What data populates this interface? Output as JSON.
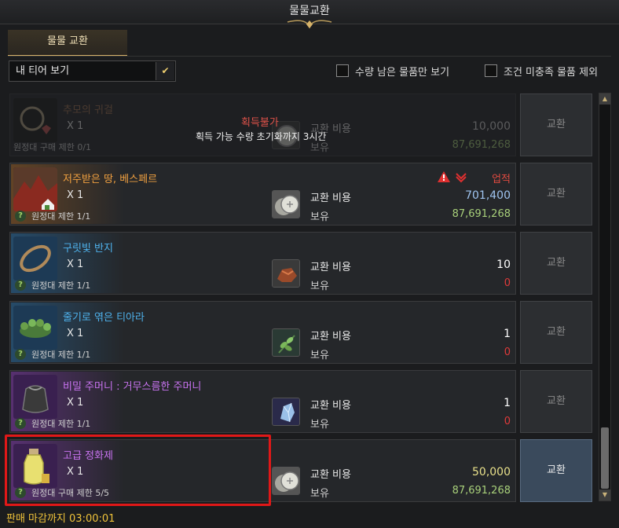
{
  "window": {
    "title": "물물교환"
  },
  "tabs": [
    {
      "label": "물물 교환"
    }
  ],
  "filter": {
    "dropdown_value": "내 티어 보기",
    "checkbox_remaining": "수량 남은 물품만 보기",
    "checkbox_exclude": "조건 미충족 물품 제외"
  },
  "common": {
    "cost_label": "교환 비용",
    "owned_label": "보유",
    "exchange_button": "교환"
  },
  "items": [
    {
      "name": "추모의 귀걸",
      "qty": "X 1",
      "limit": "원정대 구매 제한 0/1",
      "cost": "10,000",
      "owned": "87,691,268",
      "unavailable_title": "획득불가",
      "unavailable_note": "획득 가능 수량 초기화까지 3시간",
      "name_color": "#a07050",
      "cost_color": "#cfcfcf",
      "owned_color": "#a8d07a",
      "material_icon": "silver-coin-icon",
      "item_icon": "earring-icon"
    },
    {
      "name": "저주받은 땅, 베스페르",
      "qty": "X 1",
      "limit": "원정대 제한 1/1",
      "cost": "701,400",
      "owned": "87,691,268",
      "tag": "업적",
      "name_color": "#f0a040",
      "cost_color": "#9fc4f0",
      "owned_color": "#a8d07a",
      "material_icon": "silver-coin-icon",
      "item_icon": "island-icon"
    },
    {
      "name": "구릿빛 반지",
      "qty": "X 1",
      "limit": "원정대 제한 1/1",
      "cost": "10",
      "owned": "0",
      "name_color": "#4fb3ee",
      "cost_color": "#ffffff",
      "owned_color": "#e03a3a",
      "material_icon": "copper-ore-icon",
      "item_icon": "ring-icon"
    },
    {
      "name": "줄기로 엮은 티아라",
      "qty": "X 1",
      "limit": "원정대 제한 1/1",
      "cost": "1",
      "owned": "0",
      "name_color": "#4fb3ee",
      "cost_color": "#ffffff",
      "owned_color": "#e03a3a",
      "material_icon": "herb-icon",
      "item_icon": "tiara-icon"
    },
    {
      "name": "비밀 주머니 : 거무스름한 주머니",
      "qty": "X 1",
      "limit": "원정대 제한 1/1",
      "cost": "1",
      "owned": "0",
      "name_color": "#c873f0",
      "cost_color": "#ffffff",
      "owned_color": "#e03a3a",
      "material_icon": "crystal-icon",
      "item_icon": "pouch-icon"
    },
    {
      "name": "고급 정화제",
      "qty": "X 1",
      "limit": "원정대 구매 제한 5/5",
      "cost": "50,000",
      "owned": "87,691,268",
      "name_color": "#c873f0",
      "cost_color": "#e8e08a",
      "owned_color": "#a8d07a",
      "material_icon": "silver-coin-icon",
      "item_icon": "potion-icon"
    }
  ],
  "footer": {
    "deadline": "판매 마감까지 03:00:01"
  },
  "colors": {
    "accent_gold": "#d7b36a",
    "highlight_red": "#e01818",
    "deadline_yellow": "#f0c33a"
  }
}
